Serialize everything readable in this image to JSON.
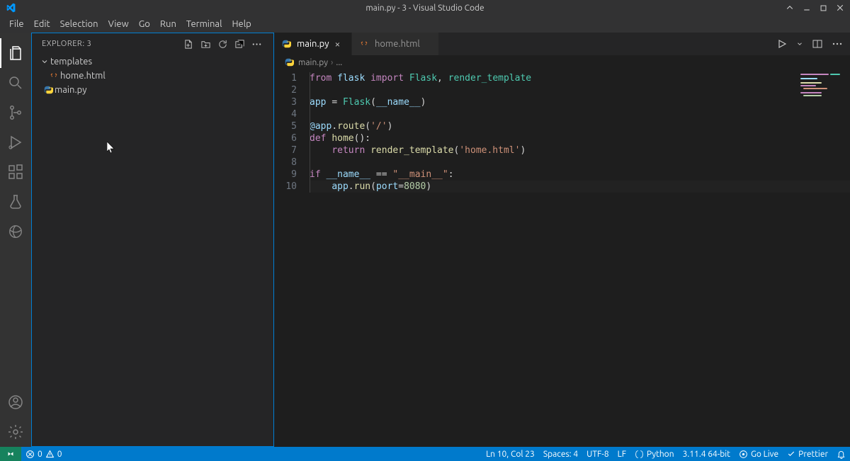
{
  "titlebar": {
    "title": "main.py - 3 - Visual Studio Code"
  },
  "menubar": [
    "File",
    "Edit",
    "Selection",
    "View",
    "Go",
    "Run",
    "Terminal",
    "Help"
  ],
  "sidebar": {
    "header": "EXPLORER: 3",
    "tree": {
      "folder": "templates",
      "file_html": "home.html",
      "file_py": "main.py"
    }
  },
  "tabs": {
    "active": "main.py",
    "inactive": "home.html"
  },
  "breadcrumbs": {
    "file": "main.py",
    "rest": "..."
  },
  "code": {
    "l1_from": "from ",
    "l1_flask": "flask ",
    "l1_import": "import ",
    "l1_Flask": "Flask",
    "l1_comma": ", ",
    "l1_rt": "render_template",
    "l3_app": "app ",
    "l3_eq": "= ",
    "l3_Flask": "Flask",
    "l3_op": "(",
    "l3_name": "__name__",
    "l3_cl": ")",
    "l5_dec": "@app",
    "l5_dot": ".",
    "l5_route": "route",
    "l5_op": "(",
    "l5_str": "'/'",
    "l5_cl": ")",
    "l6_def": "def ",
    "l6_home": "home",
    "l6_paren": "():",
    "l7_ret": "return ",
    "l7_rt": "render_template",
    "l7_op": "(",
    "l7_str": "'home.html'",
    "l7_cl": ")",
    "l9_if": "if ",
    "l9_name": "__name__",
    "l9_eq": " == ",
    "l9_str": "\"__main__\"",
    "l9_colon": ":",
    "l10_app": "app",
    "l10_dot": ".",
    "l10_run": "run",
    "l10_op": "(",
    "l10_port": "port",
    "l10_eq2": "=",
    "l10_num": "8080",
    "l10_cl": ")"
  },
  "status": {
    "errors": "0",
    "warnings": "0",
    "lncol": "Ln 10, Col 23",
    "spaces": "Spaces: 4",
    "encoding": "UTF-8",
    "eol": "LF",
    "lang": "Python",
    "pyver": "3.11.4 64-bit",
    "golive": "Go Live",
    "prettier": "Prettier"
  }
}
